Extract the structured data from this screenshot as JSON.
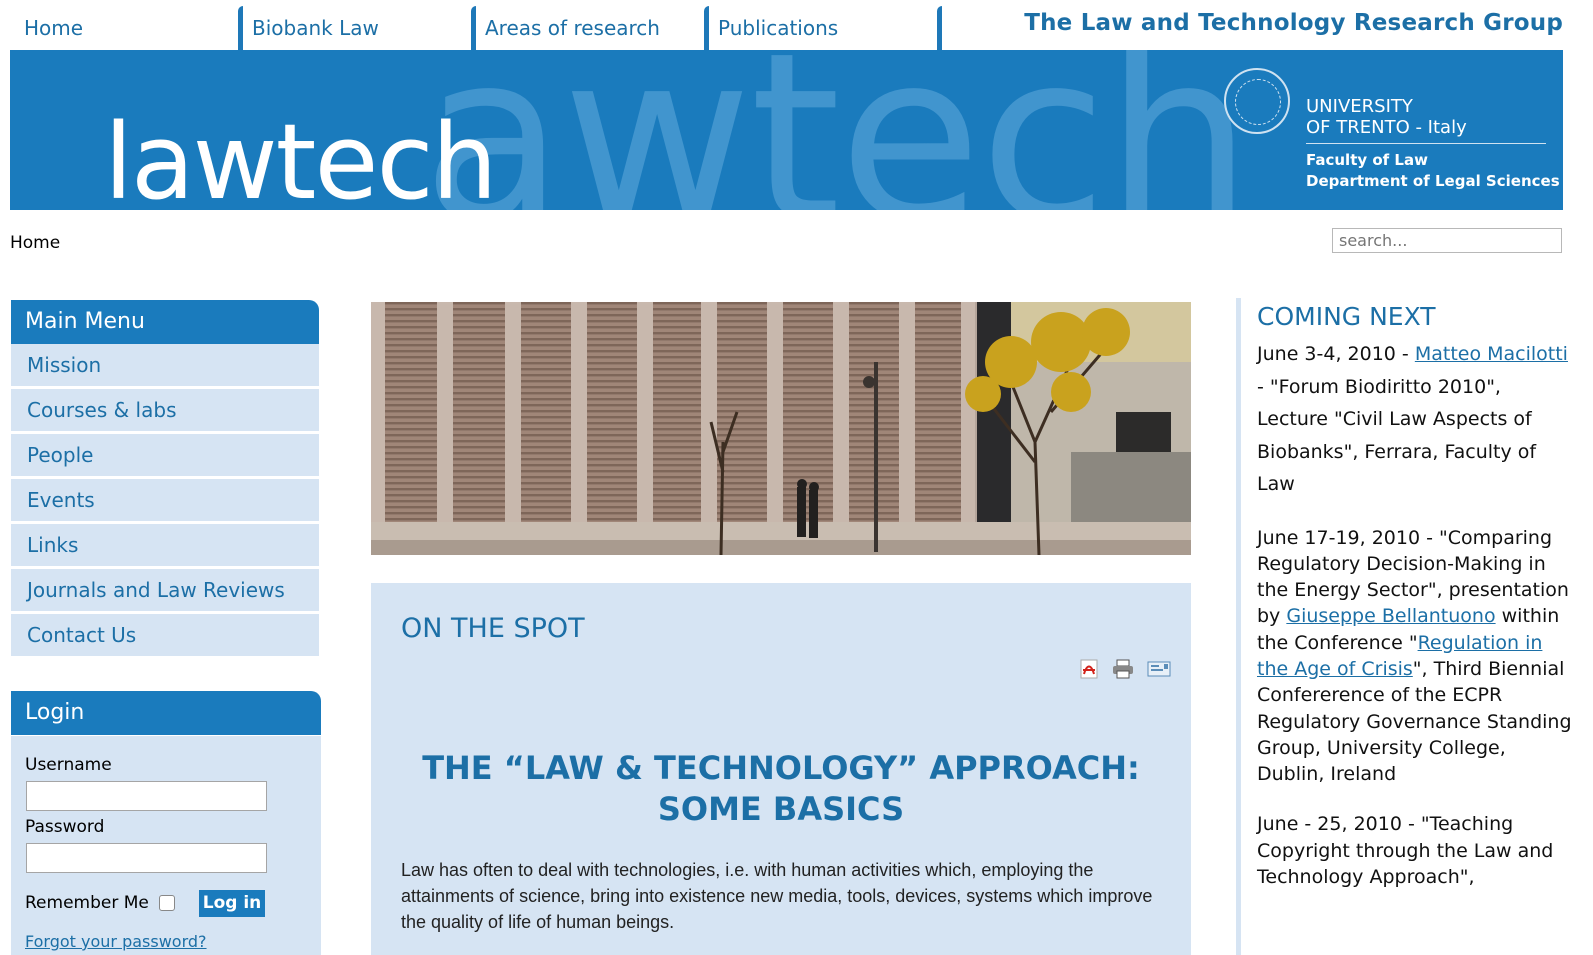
{
  "topnav": {
    "tabs": [
      "Home",
      "Biobank Law",
      "Areas of research",
      "Publications"
    ],
    "group_title": "The Law and Technology Research Group"
  },
  "banner": {
    "logo": "lawtech",
    "ghost": "awtech",
    "university_line1": "UNIVERSITY",
    "university_line2": "OF TRENTO - Italy",
    "faculty": "Faculty of Law",
    "department": "Department of Legal Sciences"
  },
  "breadcrumb": "Home",
  "search": {
    "placeholder": "search..."
  },
  "main_menu": {
    "title": "Main Menu",
    "items": [
      "Mission",
      "Courses & labs",
      "People",
      "Events",
      "Links",
      "Journals and Law Reviews",
      "Contact Us"
    ]
  },
  "login": {
    "title": "Login",
    "username_label": "Username",
    "password_label": "Password",
    "remember_label": "Remember Me",
    "button": "Log in",
    "forgot": "Forgot your password?"
  },
  "article": {
    "section": "ON THE SPOT",
    "title_line1": "THE “LAW & TECHNOLOGY” APPROACH:",
    "title_line2": "SOME BASICS",
    "body": "Law has often to deal with technologies, i.e. with human activities which, employing the attainments of science, bring into existence new media, tools, devices, systems which  improve the quality of life of human beings."
  },
  "coming_next": {
    "title": "COMING NEXT",
    "ev1_a": "June 3-4, 2010 - ",
    "ev1_link": "Matteo Macilotti",
    "ev1_b": " - \"Forum Biodiritto 2010\", Lecture \"Civil Law Aspects of Biobanks\", Ferrara, Faculty of Law",
    "ev2_a": "June 17-19, 2010 - \"Comparing Regulatory Decision-Making in the Energy Sector\", presentation by ",
    "ev2_link1": "Giuseppe Bellantuono",
    "ev2_b": " within the Conference \"",
    "ev2_link2": "Regulation in the Age of Crisis",
    "ev2_c": "\", Third Biennial Confererence of the ECPR Regulatory Governance Standing Group, University College, Dublin, Ireland",
    "ev3": "June - 25, 2010 - \"Teaching Copyright through the Law and Technology Approach\","
  },
  "colors": {
    "accent": "#1a7bbd",
    "link": "#1c6fa6",
    "panel": "#d6e4f3"
  },
  "icons": [
    "pdf-icon",
    "print-icon",
    "email-icon"
  ]
}
